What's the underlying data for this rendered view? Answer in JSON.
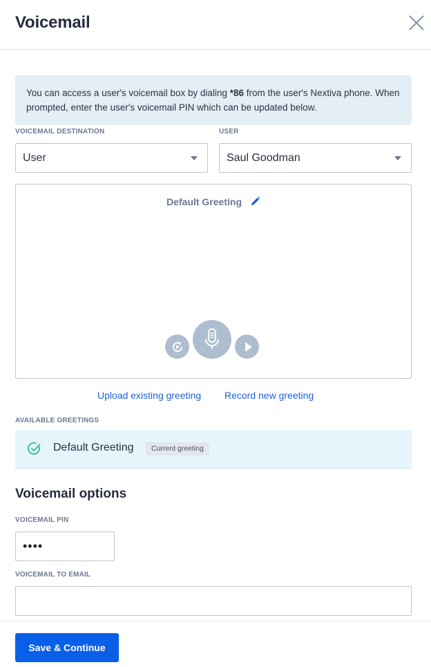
{
  "dialog": {
    "title": "Voicemail"
  },
  "info": {
    "text_before": "You can access a user's voicemail box by dialing ",
    "code": "*86",
    "text_after": " from the user's Nextiva phone. When prompted, enter the user's voicemail PIN which can be updated below."
  },
  "destination": {
    "label": "VOICEMAIL DESTINATION",
    "value": "User"
  },
  "user": {
    "label": "USER",
    "value": "Saul Goodman"
  },
  "greeting": {
    "title": "Default Greeting",
    "icons": [
      "pencil-icon",
      "refresh-icon",
      "microphone-icon",
      "play-icon"
    ]
  },
  "links": {
    "upload": "Upload existing greeting",
    "record": "Record new greeting"
  },
  "available": {
    "label": "AVAILABLE GREETINGS",
    "items": [
      {
        "name": "Default Greeting",
        "badge": "Current greeting"
      }
    ]
  },
  "options": {
    "title": "Voicemail options",
    "pin_label": "VOICEMAIL PIN",
    "pin_value": "••••",
    "email_label": "VOICEMAIL TO EMAIL",
    "email_value": ""
  },
  "footer": {
    "save_label": "Save & Continue"
  },
  "colors": {
    "primary": "#0a5fe8",
    "link": "#1f5fd9",
    "info_bg": "#e3eef5",
    "check": "#3bbf9e",
    "control": "#aebdcf"
  }
}
